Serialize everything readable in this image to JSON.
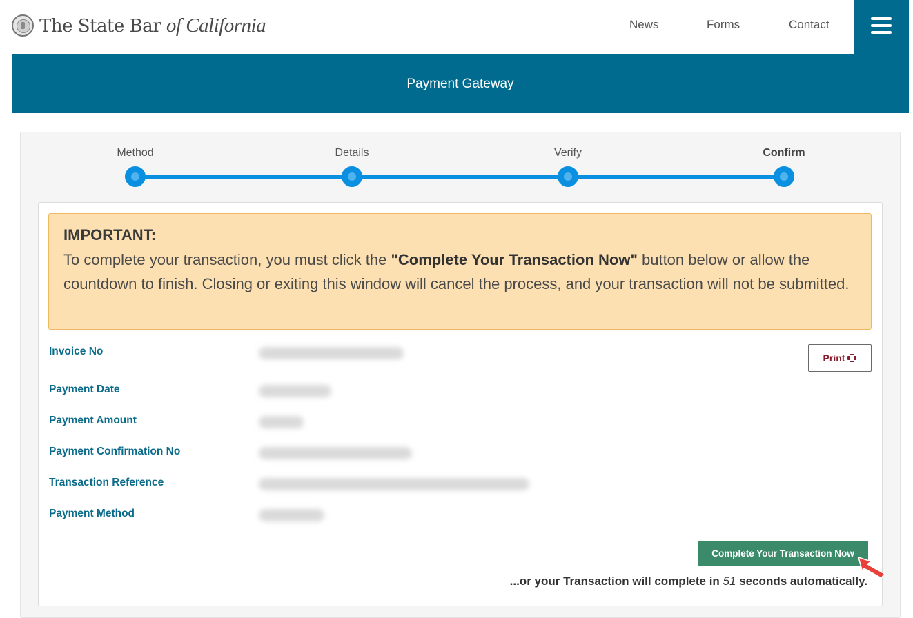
{
  "header": {
    "logo_text_main": "The State Bar",
    "logo_text_italic": "of California",
    "nav": [
      "News",
      "Forms",
      "Contact"
    ]
  },
  "banner": {
    "title": "Payment Gateway"
  },
  "stepper": {
    "steps": [
      "Method",
      "Details",
      "Verify",
      "Confirm"
    ],
    "active": "Confirm"
  },
  "alert": {
    "heading": "IMPORTANT:",
    "text_before": "To complete your transaction, you must click the ",
    "text_bold": "\"Complete Your Transaction Now\"",
    "text_after": " button below or allow the countdown to finish. Closing or exiting this window will cancel the process, and your transaction will not be submitted."
  },
  "details": {
    "labels": [
      "Invoice No",
      "Payment Date",
      "Payment Amount",
      "Payment Confirmation No",
      "Transaction Reference",
      "Payment Method"
    ]
  },
  "print_button": {
    "label": "Print"
  },
  "complete_button": {
    "label": "Complete Your Transaction Now"
  },
  "countdown": {
    "prefix": "...or your Transaction will complete in ",
    "seconds": "51",
    "suffix": " seconds automatically."
  },
  "colors": {
    "brand": "#006b8f",
    "step": "#0b8fe0",
    "alert_bg": "#fde0b1",
    "label": "#0a6b8a",
    "complete_btn": "#3b8a6a",
    "print_text": "#8b1c2b"
  }
}
